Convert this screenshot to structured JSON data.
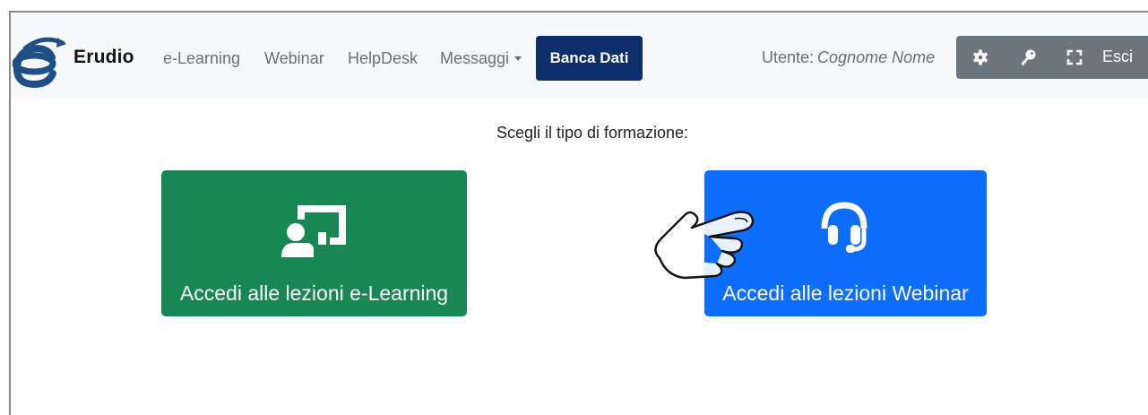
{
  "navbar": {
    "brand": "Erudio",
    "links": [
      {
        "label": "e-Learning"
      },
      {
        "label": "Webinar"
      },
      {
        "label": "HelpDesk"
      },
      {
        "label": "Messaggi"
      }
    ],
    "banca_dati": "Banca Dati",
    "user_label": "Utente:",
    "user_name": "Cognome Nome",
    "toolbar": {
      "icons": [
        "gear-icon",
        "key-icon",
        "fullscreen-icon"
      ],
      "logout": "Esci"
    }
  },
  "main": {
    "prompt": "Scegli il tipo di formazione:",
    "cards": [
      {
        "label": "Accedi alle lezioni e-Learning",
        "icon": "teacher-board-icon",
        "color": "#198754"
      },
      {
        "label": "Accedi alle lezioni Webinar",
        "icon": "headset-icon",
        "color": "#0d6efd"
      }
    ]
  },
  "colors": {
    "navbar_bg": "#f8f9fa",
    "banca_dati_bg": "#0d2d6b",
    "toolbar_bg": "#6c757d",
    "logo_blue": "#1f4f86"
  }
}
